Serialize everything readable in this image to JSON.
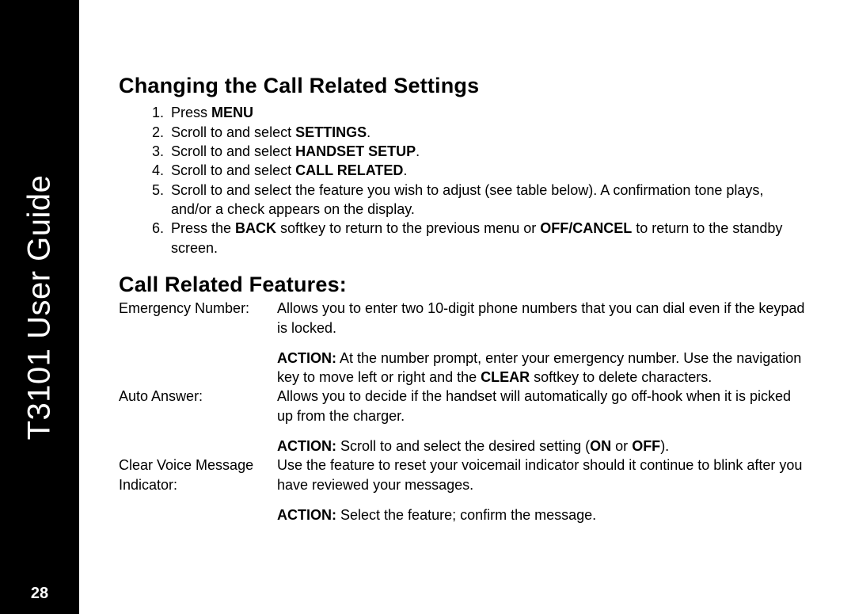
{
  "sidebar": {
    "title": "T3101 User Guide",
    "page_number": "28"
  },
  "heading1": "Changing the Call Related Settings",
  "steps": {
    "s1_a": "Press ",
    "s1_b": "MENU",
    "s2_a": "Scroll to and select ",
    "s2_b": "SETTINGS",
    "s2_c": ".",
    "s3_a": "Scroll to and select ",
    "s3_b": "HANDSET SETUP",
    "s3_c": ".",
    "s4_a": "Scroll to and select ",
    "s4_b": "CALL RELATED",
    "s4_c": ".",
    "s5": "Scroll to and select the feature you wish to adjust (see table below). A confirmation tone plays, and/or a check appears on the display.",
    "s6_a": "Press the ",
    "s6_b": "BACK",
    "s6_c": " softkey to return to the previous menu or ",
    "s6_d": "OFF/CANCEL",
    "s6_e": " to return to the standby screen."
  },
  "heading2": "Call Related Features:",
  "features": {
    "f1_label": "Emergency Number:",
    "f1_desc1": "Allows you to enter two 10-digit phone numbers that you can dial even if the keypad is locked.",
    "f1_action_b": "ACTION:",
    "f1_action_a": " At the number prompt, enter your emergency number. Use the navigation key to move left or right and the ",
    "f1_action_c": "CLEAR",
    "f1_action_d": " softkey to delete characters.",
    "f2_label": "Auto Answer:",
    "f2_desc1": "Allows you to decide if the handset will automatically go off-hook when it is picked up from the charger.",
    "f2_action_b": "ACTION:",
    "f2_action_a": " Scroll to and select the desired setting (",
    "f2_action_c": "ON",
    "f2_action_d": " or ",
    "f2_action_e": "OFF",
    "f2_action_f": ").",
    "f3_label": "Clear Voice Message Indicator:",
    "f3_desc1": "Use the feature to reset your voicemail indicator should it continue to blink after you have reviewed your messages.",
    "f3_action_b": "ACTION:",
    "f3_action_a": " Select the feature; confirm the message."
  }
}
